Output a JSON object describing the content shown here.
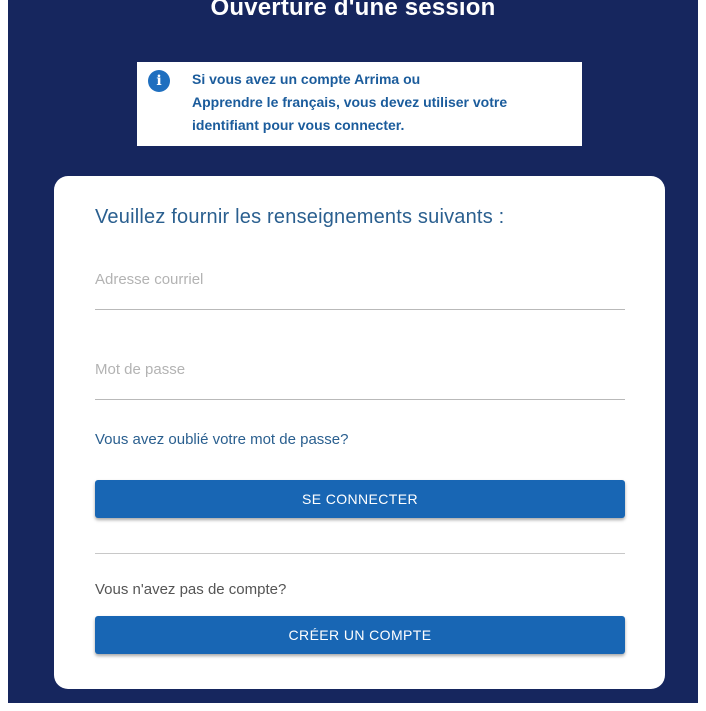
{
  "page": {
    "title": "Ouverture d'une session"
  },
  "info": {
    "icon": "info-icon",
    "lines": [
      "Si vous avez un compte Arrima ou",
      "Apprendre le français, vous devez utiliser votre",
      "identifiant pour vous connecter."
    ]
  },
  "form": {
    "heading": "Veuillez fournir les renseignements suivants :",
    "email_placeholder": "Adresse courriel",
    "email_value": "",
    "password_placeholder": "Mot de passe",
    "password_value": "",
    "forgot_link": "Vous avez oublié votre mot de passe?",
    "login_button": "SE CONNECTER",
    "no_account_text": "Vous n'avez pas de compte?",
    "create_button": "CRÉER UN COMPTE"
  },
  "colors": {
    "background": "#16265e",
    "primary_button": "#1866b4",
    "info_text": "#1b5c9c"
  }
}
